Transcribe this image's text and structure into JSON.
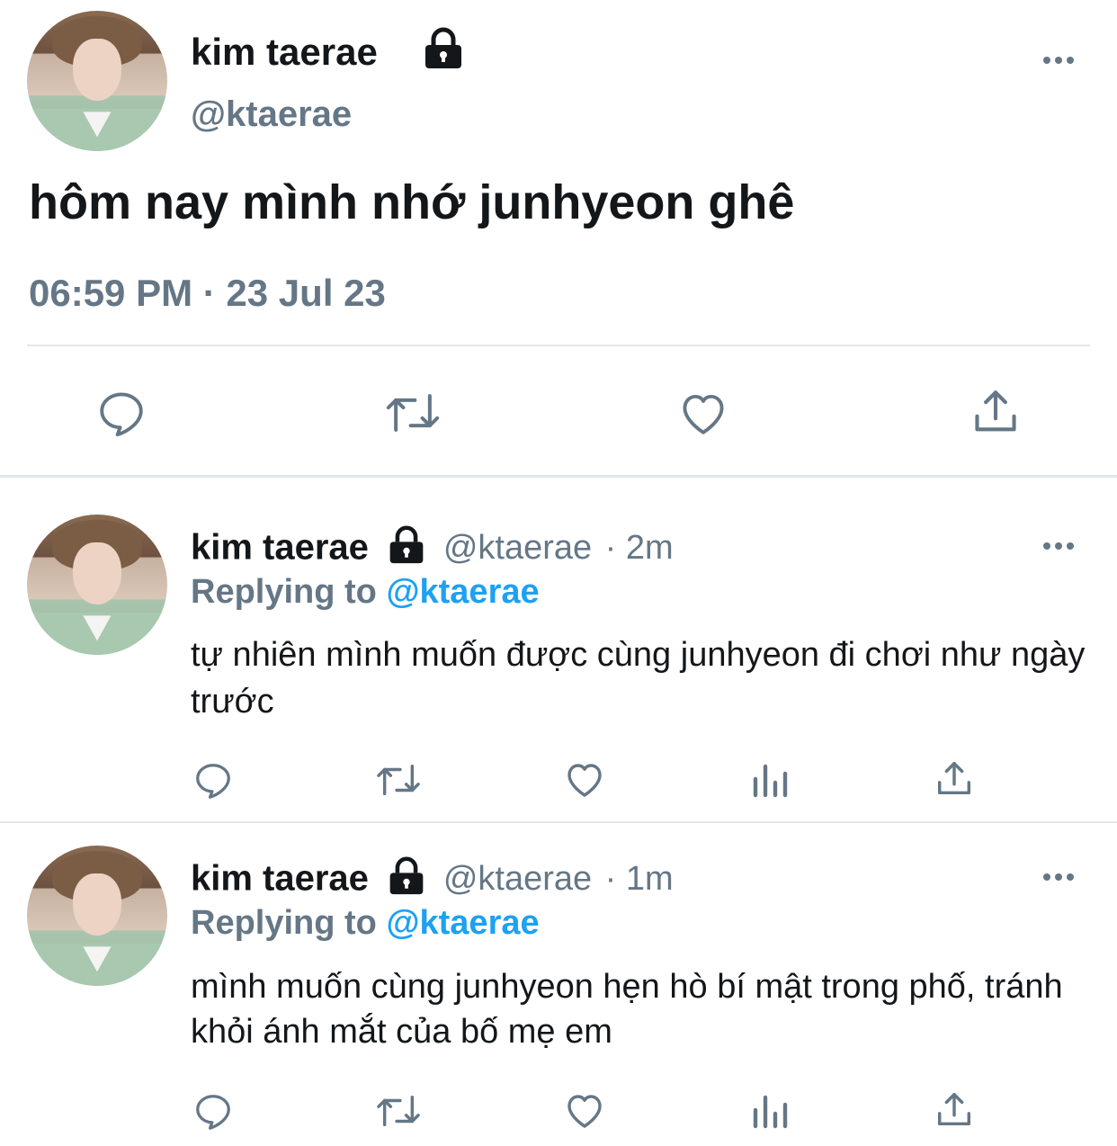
{
  "main_tweet": {
    "display_name": "kim taerae",
    "handle": "@ktaerae",
    "text": "hôm nay mình nhớ junhyeon ghê",
    "timestamp": "06:59 PM · 23 Jul 23",
    "icons": [
      "lock-icon",
      "more-icon",
      "reply-icon",
      "retweet-icon",
      "like-icon",
      "share-icon"
    ]
  },
  "replies": [
    {
      "display_name": "kim taerae",
      "handle": "@ktaerae",
      "time_ago": "· 2m",
      "replying_label": "Replying to",
      "replying_handle": "@ktaerae",
      "text": "tự nhiên mình muốn được cùng junhyeon đi chơi như ngày trước",
      "icons": [
        "reply-icon",
        "retweet-icon",
        "like-icon",
        "analytics-icon",
        "share-icon"
      ]
    },
    {
      "display_name": "kim taerae",
      "handle": "@ktaerae",
      "time_ago": "· 1m",
      "replying_label": "Replying to",
      "replying_handle": "@ktaerae",
      "text": "mình muốn cùng junhyeon hẹn hò bí mật trong phố, tránh khỏi ánh mắt của bố mẹ em",
      "icons": [
        "reply-icon",
        "retweet-icon",
        "like-icon",
        "analytics-icon",
        "share-icon"
      ]
    }
  ],
  "colors": {
    "text": "#14171a",
    "secondary": "#657786",
    "accent": "#1da1f2",
    "divider": "#e1e8ed"
  }
}
